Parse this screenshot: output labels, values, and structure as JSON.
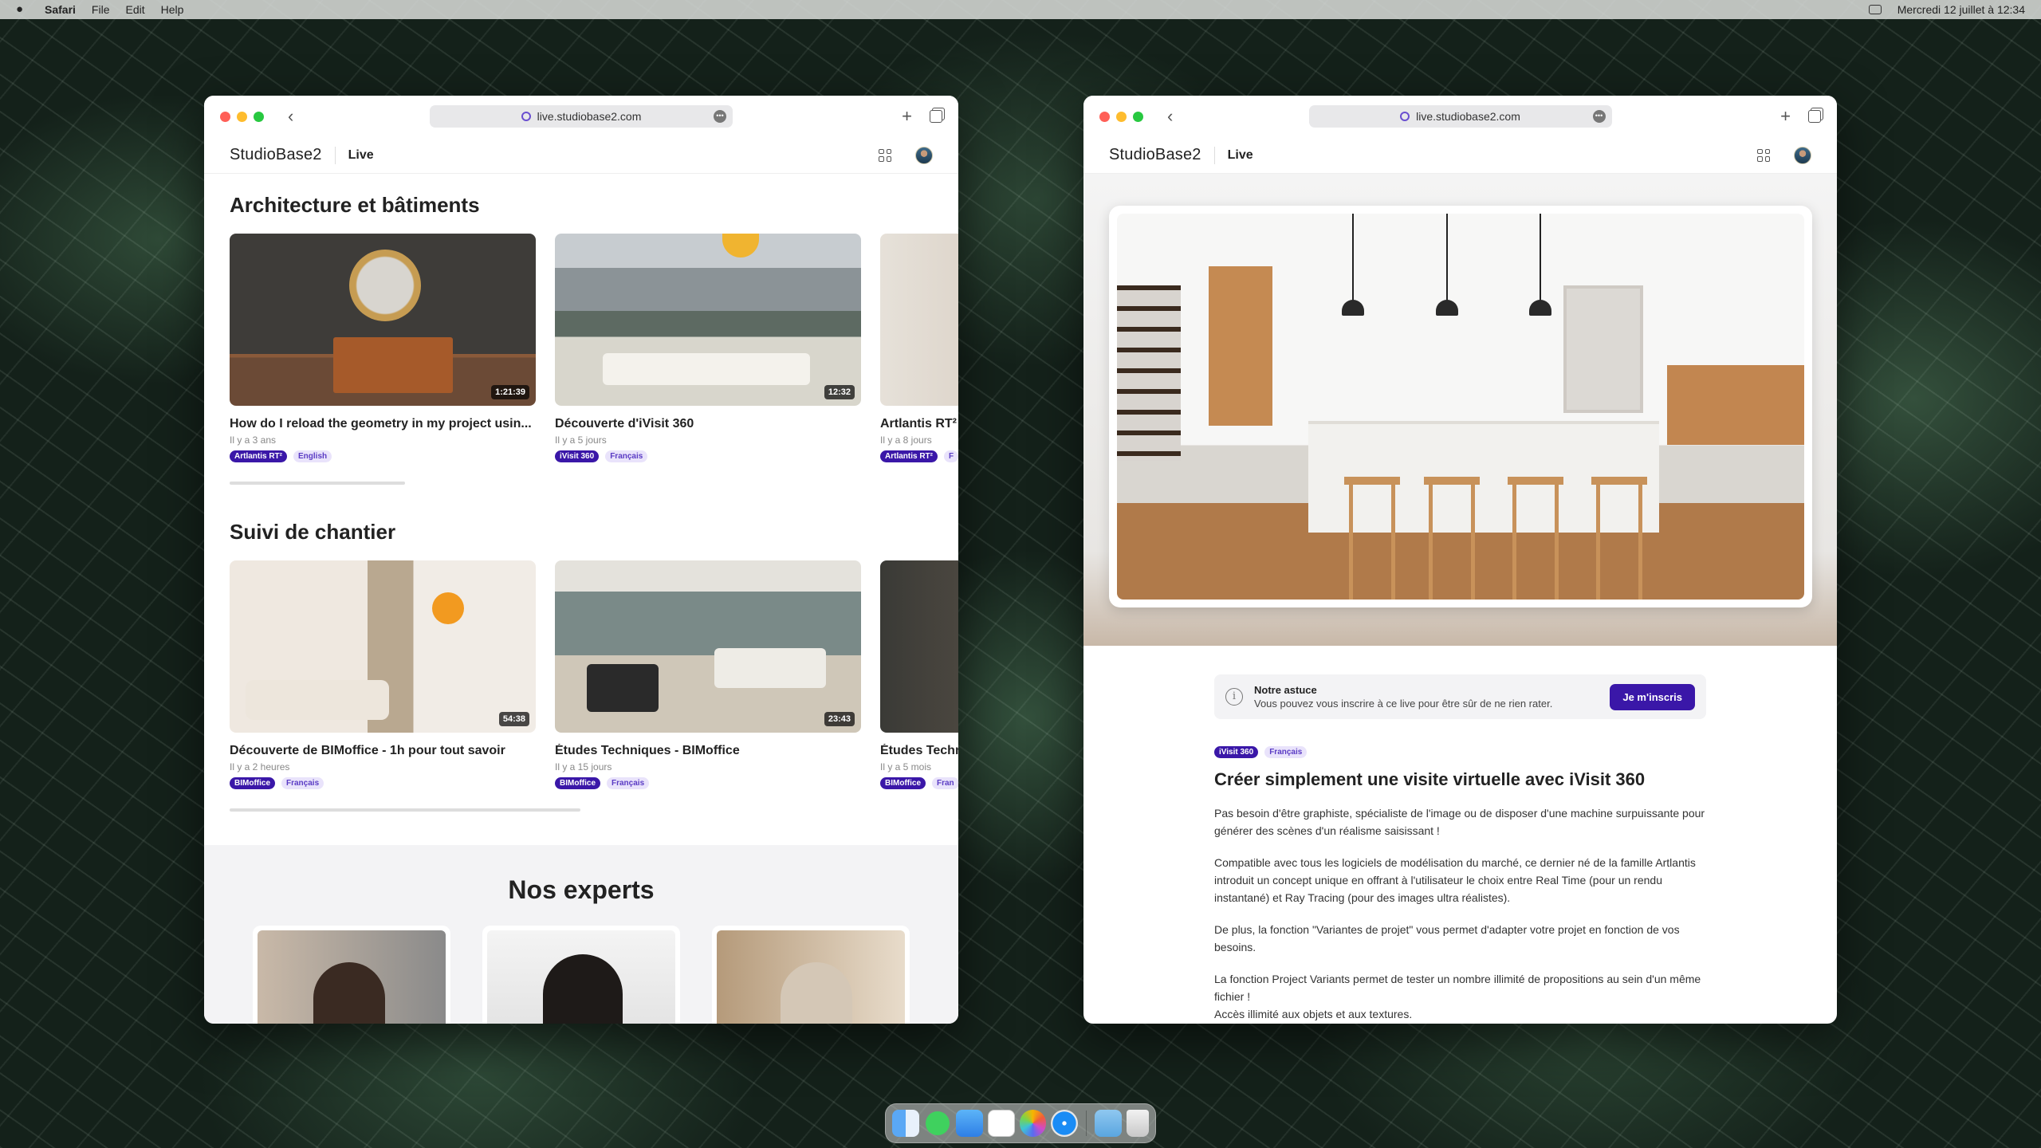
{
  "menubar": {
    "app": "Safari",
    "items": [
      "File",
      "Edit",
      "Help"
    ],
    "datetime": "Mercredi 12 juillet à 12:34"
  },
  "browser": {
    "url": "live.studiobase2.com"
  },
  "site": {
    "logo": "StudioBase2",
    "section": "Live"
  },
  "left": {
    "rows": [
      {
        "title": "Architecture et bâtiments",
        "cards": [
          {
            "title": "How do I reload the geometry in my project usin...",
            "meta": "Il y a 3 ans",
            "duration": "1:21:39",
            "tags": [
              "Artlantis RT²",
              "English"
            ]
          },
          {
            "title": "Découverte d'iVisit 360",
            "meta": "Il y a 5 jours",
            "duration": "12:32",
            "tags": [
              "iVisit 360",
              "Français"
            ]
          },
          {
            "title": "Artlantis RT²",
            "meta": "Il y a 8 jours",
            "duration": "",
            "tags": [
              "Artlantis RT²",
              "F"
            ]
          }
        ]
      },
      {
        "title": "Suivi de chantier",
        "cards": [
          {
            "title": "Découverte de BIMoffice - 1h pour tout savoir",
            "meta": "Il y a 2 heures",
            "duration": "54:38",
            "tags": [
              "BIMoffice",
              "Français"
            ]
          },
          {
            "title": "Études Techniques - BIMoffice",
            "meta": "Il y a 15 jours",
            "duration": "23:43",
            "tags": [
              "BIMoffice",
              "Français"
            ]
          },
          {
            "title": "Études Techn",
            "meta": "Il y a 5 mois",
            "duration": "",
            "tags": [
              "BIMoffice",
              "Fran"
            ]
          }
        ]
      }
    ],
    "experts_title": "Nos experts"
  },
  "right": {
    "tip": {
      "title": "Notre astuce",
      "body": "Vous pouvez vous inscrire à ce live pour être sûr de ne rien rater.",
      "button": "Je m'inscris"
    },
    "tags": [
      "iVisit 360",
      "Français"
    ],
    "title": "Créer simplement une visite virtuelle avec iVisit 360",
    "paragraphs": [
      "Pas besoin d'être graphiste, spécialiste de l'image ou de disposer d'une machine surpuissante pour générer des scènes d'un réalisme saisissant !",
      "Compatible avec tous les logiciels de modélisation du marché, ce dernier né de la famille Artlantis introduit un concept unique en offrant à l'utilisateur le choix entre Real Time (pour un rendu instantané) et Ray Tracing (pour des images ultra réalistes).",
      "De plus, la fonction \"Variantes de projet\" vous permet d'adapter votre projet en fonction de vos besoins.",
      "La fonction Project Variants permet de tester un nombre illimité de propositions au sein d'un même fichier !",
      "Accès illimité aux objets et aux textures."
    ]
  },
  "colors": {
    "accent": "#3a17a8",
    "tag_light_bg": "#e9e3fb"
  }
}
